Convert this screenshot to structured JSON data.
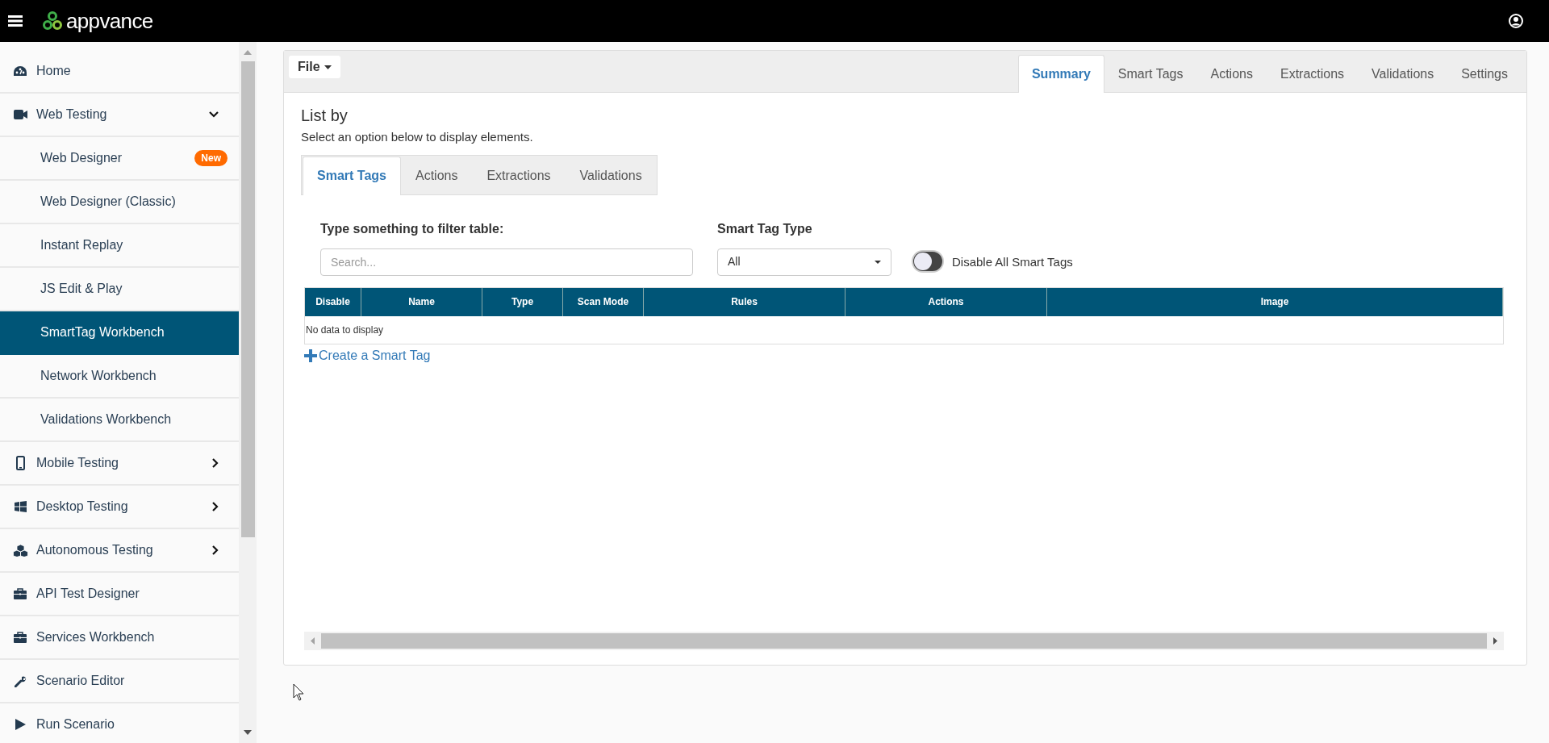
{
  "header": {
    "logo": "appvance"
  },
  "sidebar": {
    "items": [
      {
        "label": "Home",
        "selected": false
      },
      {
        "label": "Web Testing",
        "selected": false,
        "expanded": true,
        "children": [
          {
            "label": "Web Designer",
            "selected": false,
            "badge": "New"
          },
          {
            "label": "Web Designer (Classic)",
            "selected": false
          },
          {
            "label": "Instant Replay",
            "selected": false
          },
          {
            "label": "JS Edit & Play",
            "selected": false
          },
          {
            "label": "SmartTag Workbench",
            "selected": true
          },
          {
            "label": "Network Workbench",
            "selected": false
          },
          {
            "label": "Validations Workbench",
            "selected": false
          }
        ]
      },
      {
        "label": "Mobile Testing",
        "selected": false,
        "expanded": false
      },
      {
        "label": "Desktop Testing",
        "selected": false,
        "expanded": false
      },
      {
        "label": "Autonomous Testing",
        "selected": false,
        "expanded": false
      },
      {
        "label": "API Test Designer",
        "selected": false
      },
      {
        "label": "Services Workbench",
        "selected": false
      },
      {
        "label": "Scenario Editor",
        "selected": false
      },
      {
        "label": "Run Scenario",
        "selected": false
      }
    ]
  },
  "toolbar": {
    "file_menu": "File"
  },
  "top_tabs": [
    {
      "label": "Summary",
      "selected": true
    },
    {
      "label": "Smart Tags",
      "selected": false
    },
    {
      "label": "Actions",
      "selected": false
    },
    {
      "label": "Extractions",
      "selected": false
    },
    {
      "label": "Validations",
      "selected": false
    },
    {
      "label": "Settings",
      "selected": false
    }
  ],
  "list_by": {
    "title": "List by",
    "subtitle": "Select an option below to display elements."
  },
  "list_tabs": [
    {
      "label": "Smart Tags",
      "selected": true
    },
    {
      "label": "Actions",
      "selected": false
    },
    {
      "label": "Extractions",
      "selected": false
    },
    {
      "label": "Validations",
      "selected": false
    }
  ],
  "filter": {
    "label": "Type something to filter table:",
    "placeholder": "Search..."
  },
  "type_select": {
    "label": "Smart Tag Type",
    "value": "All"
  },
  "disable_toggle": {
    "label": "Disable All Smart Tags",
    "on": false
  },
  "table": {
    "columns": [
      "Disable",
      "Name",
      "Type",
      "Scan Mode",
      "Rules",
      "Actions",
      "Image"
    ],
    "empty_message": "No data to display"
  },
  "create_link": "Create a Smart Tag"
}
